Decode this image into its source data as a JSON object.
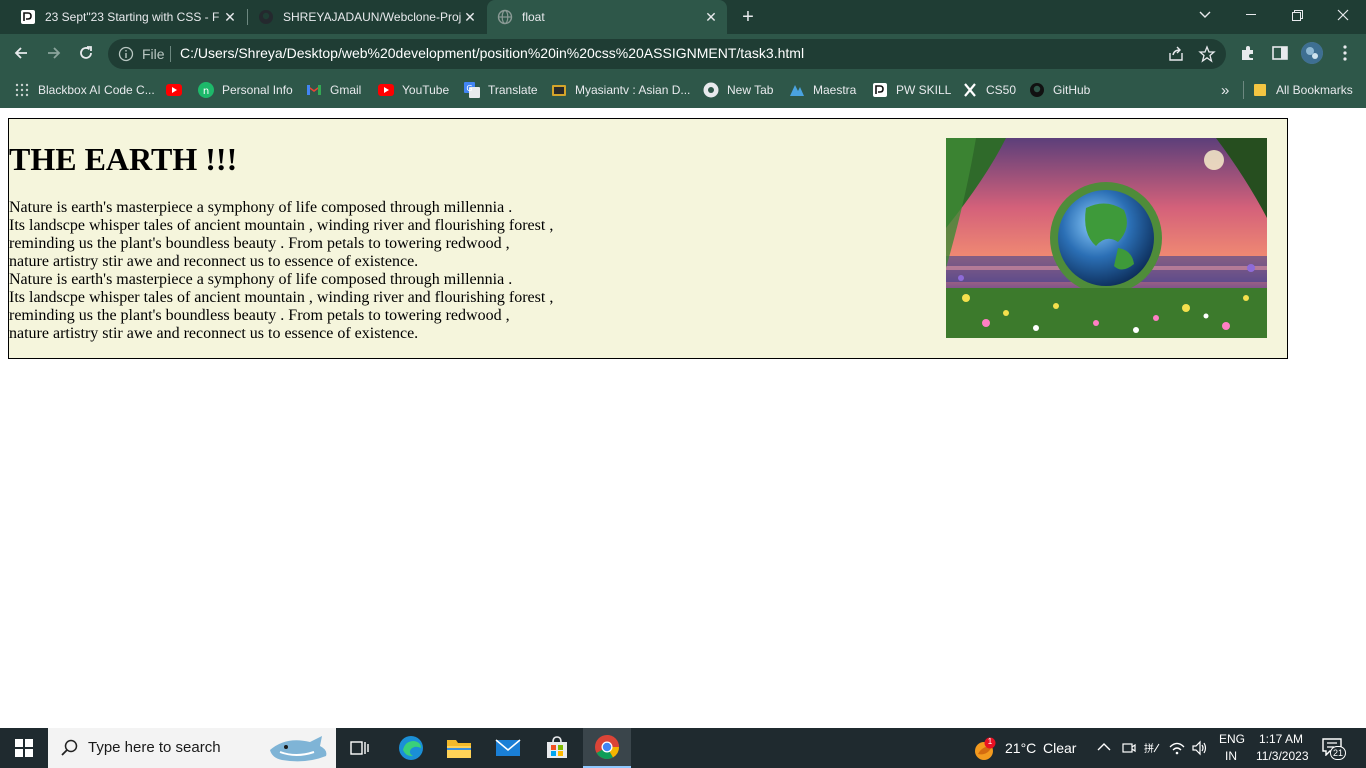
{
  "browser": {
    "tabs": [
      {
        "title": "23 Sept\"23 Starting with CSS - F",
        "icon": "pw-skills-favicon"
      },
      {
        "title": "SHREYAJADAUN/Webclone-Proj",
        "icon": "github-favicon"
      },
      {
        "title": "float",
        "icon": "globe-favicon",
        "active": true
      }
    ],
    "omnibox": {
      "scheme_label": "File",
      "url": "C:/Users/Shreya/Desktop/web%20development/position%20in%20css%20ASSIGNMENT/task3.html"
    },
    "bookmarks": [
      {
        "label": "Blackbox AI Code C...",
        "icon": "blackbox-icon"
      },
      {
        "label": "",
        "icon": "youtube-icon"
      },
      {
        "label": "Personal Info",
        "icon": "green-circle-icon"
      },
      {
        "label": "Gmail",
        "icon": "gmail-icon"
      },
      {
        "label": "YouTube",
        "icon": "youtube-icon"
      },
      {
        "label": "Translate",
        "icon": "translate-icon"
      },
      {
        "label": "Myasiantv : Asian D...",
        "icon": "myasiantv-icon"
      },
      {
        "label": "New Tab",
        "icon": "chrome-icon"
      },
      {
        "label": "Maestra",
        "icon": "maestra-icon"
      },
      {
        "label": "PW SKILL",
        "icon": "pw-skills-icon"
      },
      {
        "label": "CS50",
        "icon": "x-icon"
      },
      {
        "label": "GitHub",
        "icon": "github-icon"
      }
    ],
    "bookmarks_overflow": "»",
    "all_bookmarks": "All Bookmarks",
    "colors": {
      "frame": "#1f3d34",
      "toolbar": "#2e5749"
    }
  },
  "page": {
    "heading": "THE EARTH !!!",
    "paragraph_lines": [
      "Nature is earth's masterpiece a symphony of life composed through millennia .",
      "Its landscpe whisper tales of ancient mountain , winding river and flourishing forest ,",
      "reminding us the plant's boundless beauty . From petals to towering redwood ,",
      "nature artistry stir awe and reconnect us to essence of existence.",
      "Nature is earth's masterpiece a symphony of life composed through millennia .",
      "Its landscpe whisper tales of ancient mountain , winding river and flourishing forest ,",
      "reminding us the plant's boundless beauty . From petals to towering redwood ,",
      "nature artistry stir awe and reconnect us to essence of existence."
    ],
    "image_alt": "earth-image",
    "colors": {
      "box_bg": "#f5f5dc"
    }
  },
  "taskbar": {
    "search_placeholder": "Type here to search",
    "weather": {
      "temp": "21°C",
      "condition": "Clear",
      "badge": "1"
    },
    "language": {
      "line1": "ENG",
      "line2": "IN"
    },
    "clock": {
      "time": "1:17 AM",
      "date": "11/3/2023"
    },
    "notifications": "21"
  }
}
